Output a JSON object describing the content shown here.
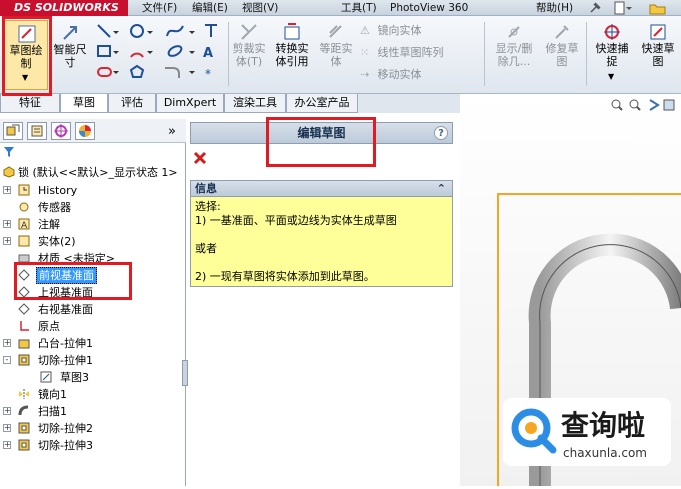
{
  "titlebar": {
    "logo": "DS SOLIDWORKS",
    "menus": [
      "文件(F)",
      "编辑(E)",
      "视图(V)",
      "工具(T)",
      "PhotoView 360",
      "帮助(H)"
    ]
  },
  "ribbon": {
    "sketch_label": "草图绘\n制",
    "smart_dim_label": "智能尺\n寸",
    "cut_entities_label": "剪裁实\n体(T)",
    "convert_entities_label": "转换实\n体引用",
    "offset_entities_label": "等距实\n体",
    "mirror_entities_label": "镜向实体",
    "linear_pattern_label": "线性草图阵列",
    "move_entities_label": "移动实体",
    "show_hide_label": "显示/删\n除几...",
    "repair_sketch_label": "修复草\n图",
    "quick_snap_label": "快速捕\n捉",
    "rapid_sketch_label": "快速草\n图"
  },
  "command_tabs": [
    "特征",
    "草图",
    "评估",
    "DimXpert",
    "渲染工具",
    "办公室产品"
  ],
  "feature_tree": {
    "root": "锁  (默认<<默认>_显示状态 1>",
    "items": [
      {
        "label": "History",
        "icon": "history-icon",
        "indent": 1,
        "expander": "+"
      },
      {
        "label": "传感器",
        "icon": "sensor-icon",
        "indent": 1,
        "expander": ""
      },
      {
        "label": "注解",
        "icon": "annotation-icon",
        "indent": 1,
        "expander": "+"
      },
      {
        "label": "实体(2)",
        "icon": "solid-bodies-icon",
        "indent": 1,
        "expander": "+"
      },
      {
        "label": "材质 <未指定>",
        "icon": "material-icon",
        "indent": 1,
        "expander": ""
      },
      {
        "label": "前视基准面",
        "icon": "plane-icon",
        "indent": 1,
        "expander": "",
        "selected": true
      },
      {
        "label": "上视基准面",
        "icon": "plane-icon",
        "indent": 1,
        "expander": ""
      },
      {
        "label": "右视基准面",
        "icon": "plane-icon",
        "indent": 1,
        "expander": ""
      },
      {
        "label": "原点",
        "icon": "origin-icon",
        "indent": 1,
        "expander": ""
      },
      {
        "label": "凸台-拉伸1",
        "icon": "boss-extrude-icon",
        "indent": 1,
        "expander": "+"
      },
      {
        "label": "切除-拉伸1",
        "icon": "cut-extrude-icon",
        "indent": 1,
        "expander": "-"
      },
      {
        "label": "草图3",
        "icon": "sketch-icon",
        "indent": 2,
        "expander": ""
      },
      {
        "label": "镜向1",
        "icon": "mirror-icon",
        "indent": 1,
        "expander": ""
      },
      {
        "label": "扫描1",
        "icon": "sweep-icon",
        "indent": 1,
        "expander": "+"
      },
      {
        "label": "切除-拉伸2",
        "icon": "cut-extrude-icon",
        "indent": 1,
        "expander": "+"
      },
      {
        "label": "切除-拉伸3",
        "icon": "cut-extrude-icon",
        "indent": 1,
        "expander": "+"
      }
    ]
  },
  "property_manager": {
    "title": "编辑草图",
    "help": "?",
    "info_header": "信息",
    "info_lines": [
      "选择:",
      "1) 一基准面、平面或边线为实体生成草图",
      "",
      "或者",
      "",
      "2) 一现有草图将实体添加到此草图。"
    ]
  },
  "watermark": {
    "brand": "查询啦",
    "url": "chaxunla.com"
  },
  "colors": {
    "highlight": "#e21b23",
    "selection": "#3399ff",
    "info_bg": "#ffff9a",
    "logo_bg": "#c8102e"
  }
}
